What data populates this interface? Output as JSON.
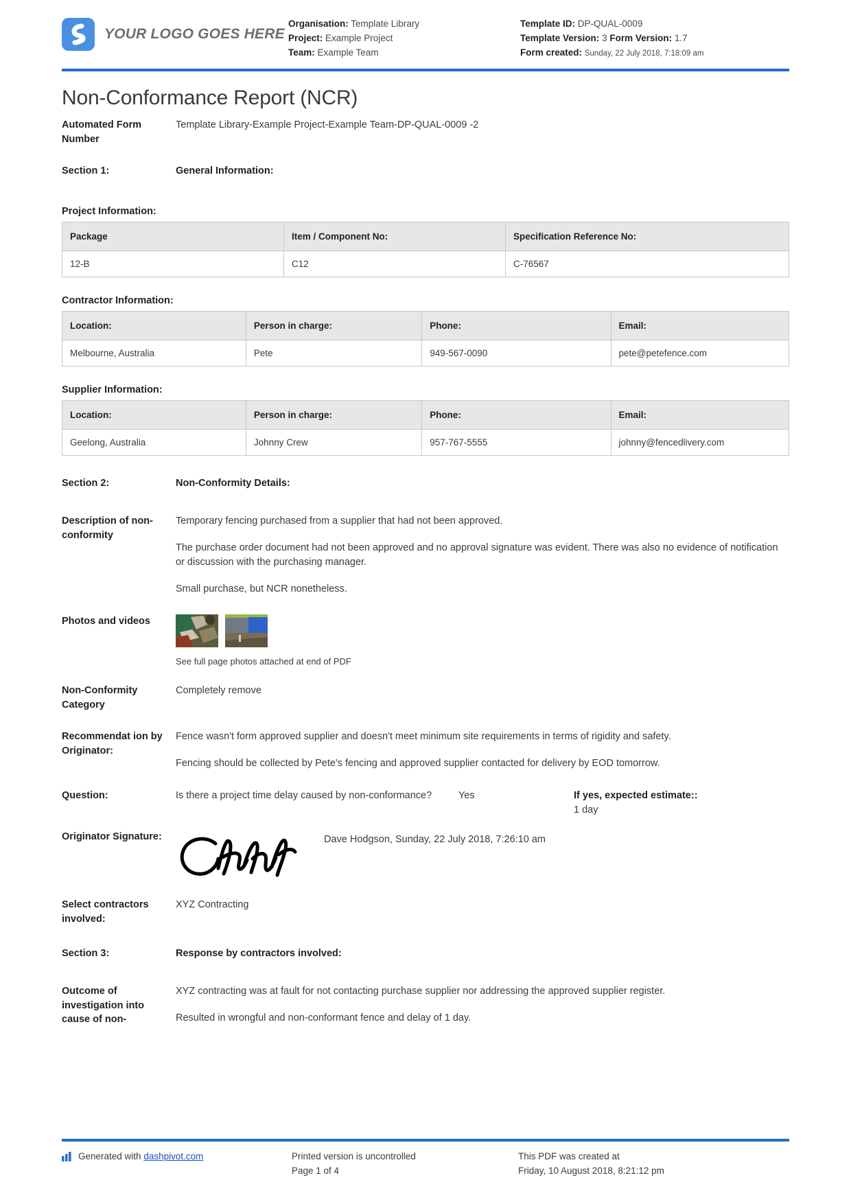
{
  "header": {
    "logo_text": "YOUR LOGO GOES HERE",
    "left_meta": [
      {
        "label": "Organisation:",
        "value": "Template Library"
      },
      {
        "label": "Project:",
        "value": "Example Project"
      },
      {
        "label": "Team:",
        "value": "Example Team"
      }
    ],
    "right_meta": {
      "template_id_label": "Template ID:",
      "template_id_value": "DP-QUAL-0009",
      "template_version_label": "Template Version:",
      "template_version_value": "3",
      "form_version_label": "Form Version:",
      "form_version_value": "1.7",
      "form_created_label": "Form created:",
      "form_created_value": "Sunday, 22 July 2018, 7:18:09 am"
    },
    "accent_color": "#1f6fc4",
    "logo_color": "#4a90e2"
  },
  "title": "Non-Conformance Report (NCR)",
  "automated_form": {
    "label": "Automated Form Number",
    "value": "Template Library-Example Project-Example Team-DP-QUAL-0009   -2"
  },
  "section1": {
    "label": "Section 1:",
    "heading": "General Information:"
  },
  "project_information": {
    "subhead": "Project Information:",
    "columns": [
      "Package",
      "Item / Component No:",
      "Specification Reference No:"
    ],
    "rows": [
      [
        "12-B",
        "C12",
        "C-76567"
      ]
    ]
  },
  "contractor_information": {
    "subhead": "Contractor Information:",
    "columns": [
      "Location:",
      "Person in charge:",
      "Phone:",
      "Email:"
    ],
    "rows": [
      [
        "Melbourne, Australia",
        "Pete",
        "949-567-0090",
        "pete@petefence.com"
      ]
    ]
  },
  "supplier_information": {
    "subhead": "Supplier Information:",
    "columns": [
      "Location:",
      "Person in charge:",
      "Phone:",
      "Email:"
    ],
    "rows": [
      [
        "Geelong, Australia",
        "Johnny Crew",
        "957-767-5555",
        "johnny@fencedlivery.com"
      ]
    ]
  },
  "section2": {
    "label": "Section 2:",
    "heading": "Non-Conformity Details:"
  },
  "description": {
    "label": "Description of non-conformity",
    "paragraphs": [
      "Temporary fencing purchased from a supplier that had not been approved.",
      "The purchase order document had not been approved and no approval signature was evident. There was also no evidence of notification or discussion with the purchasing manager.",
      "Small purchase, but NCR nonetheless."
    ]
  },
  "photos": {
    "label": "Photos and videos",
    "caption": "See full page photos attached at end of PDF",
    "count": 2
  },
  "category": {
    "label": "Non-Conformity Category",
    "value": "Completely remove"
  },
  "recommendation": {
    "label": "Recommendat ion by Originator:",
    "paragraphs": [
      "Fence wasn't form approved supplier and doesn't meet minimum site requirements in terms of rigidity and safety.",
      "Fencing should be collected by Pete's fencing and approved supplier contacted for delivery by EOD tomorrow."
    ]
  },
  "question": {
    "label": "Question:",
    "text": "Is there a project time delay caused by non-conformance?",
    "answer": "Yes",
    "estimate_label": "If yes, expected estimate::",
    "estimate_value": "1 day"
  },
  "signature": {
    "label": "Originator Signature:",
    "meta": "Dave Hodgson, Sunday, 22 July 2018, 7:26:10 am"
  },
  "contractors": {
    "label": "Select contractors involved:",
    "value": "XYZ Contracting"
  },
  "section3": {
    "label": "Section 3:",
    "heading": "Response by contractors involved:"
  },
  "outcome": {
    "label": "Outcome of investigation into cause of non-",
    "paragraphs": [
      "XYZ contracting was at fault for not contacting purchase supplier nor addressing the approved supplier register.",
      "Resulted in wrongful and non-conformant fence and delay of 1 day."
    ]
  },
  "footer": {
    "generated_prefix": "Generated with ",
    "generated_link": "dashpivot.com",
    "printed_line1": "Printed version is uncontrolled",
    "printed_line2": "Page 1 of 4",
    "created_line1": "This PDF was created at",
    "created_line2": "Friday, 10 August 2018, 8:21:12 pm"
  }
}
